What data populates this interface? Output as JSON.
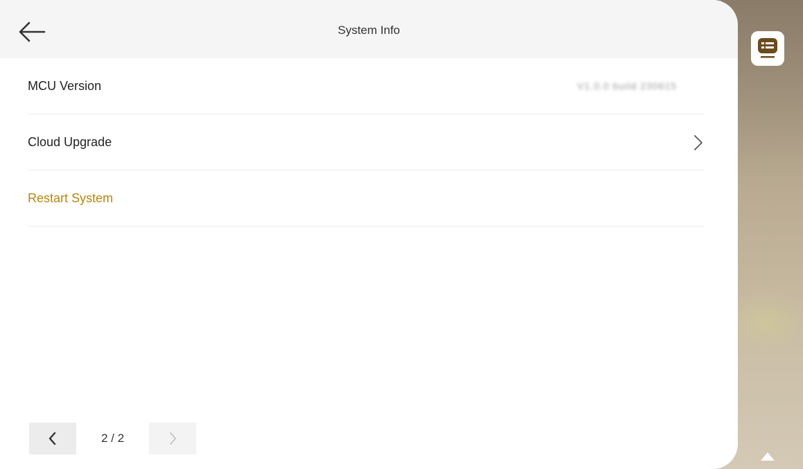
{
  "header": {
    "title": "System Info"
  },
  "rows": [
    {
      "label": "MCU Version",
      "value": "V1.0.0 build 230615",
      "value_blurred": true
    },
    {
      "label": "Cloud Upgrade",
      "has_chevron": true
    },
    {
      "label": "Restart System",
      "accent_color": "#b8860b"
    }
  ],
  "pager": {
    "indicator": "2 / 2"
  },
  "icons": {
    "back": "back-arrow-icon",
    "chevron_right": "chevron-right-icon",
    "prev": "chevron-left-icon",
    "next": "chevron-right-icon",
    "menu": "list-menu-icon",
    "up": "triangle-up-icon"
  },
  "colors": {
    "accent": "#b8860b",
    "menu_icon": "#6b4a1e",
    "header_bg": "#f5f5f5"
  }
}
